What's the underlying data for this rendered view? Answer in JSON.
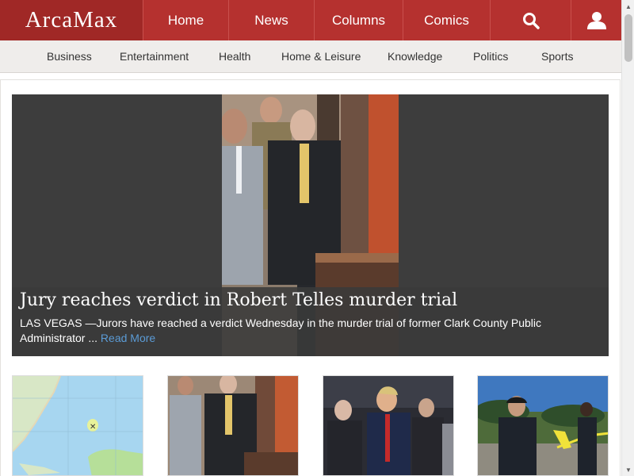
{
  "brand": {
    "logo_text": "ArcaMax"
  },
  "nav": {
    "home": "Home",
    "news": "News",
    "columns": "Columns",
    "comics": "Comics",
    "search_icon": "search-icon",
    "user_icon": "user-icon"
  },
  "categories": [
    "Business",
    "Entertainment",
    "Health",
    "Home & Leisure",
    "Knowledge",
    "Politics",
    "Sports"
  ],
  "hero": {
    "title": "Jury reaches verdict in Robert Telles murder trial",
    "summary": "LAS VEGAS —Jurors have reached a verdict Wednesday in the murder trial of former Clark County Public Administrator ...",
    "read_more": "Read More"
  },
  "colors": {
    "brand_red": "#b5312f",
    "logo_red": "#a02826",
    "link_blue": "#5b9bd5"
  }
}
